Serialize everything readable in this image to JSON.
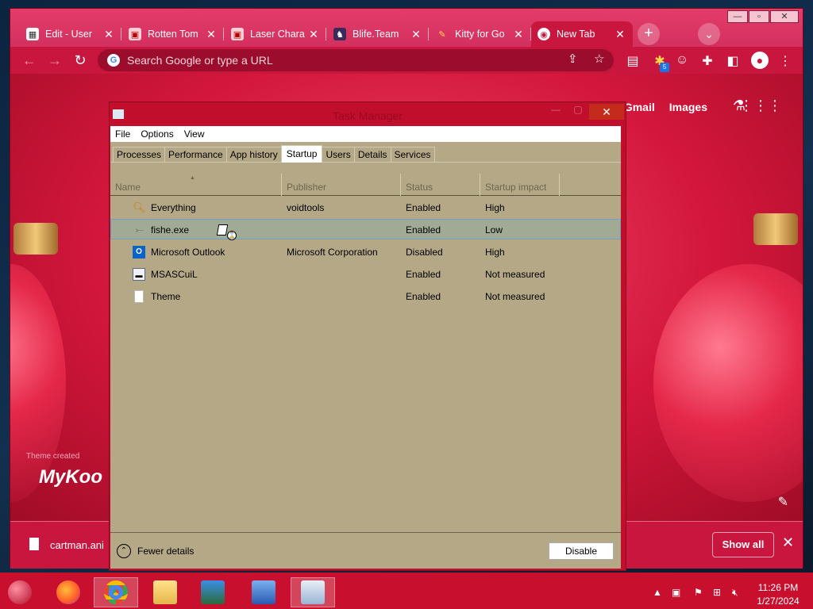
{
  "browser": {
    "window_controls": {
      "minimize": "—",
      "maximize": "▫",
      "close": "✕"
    },
    "tabs": [
      {
        "label": "Edit - User",
        "icon": "document-grid-icon",
        "active": false
      },
      {
        "label": "Rotten Tom",
        "icon": "image-icon",
        "active": false
      },
      {
        "label": "Laser Chara",
        "icon": "image-icon",
        "active": false
      },
      {
        "label": "Blife.Team",
        "icon": "character-icon",
        "active": false
      },
      {
        "label": "Kitty for Go",
        "icon": "kitty-icon",
        "active": false
      },
      {
        "label": "New Tab",
        "icon": "chrome-icon",
        "active": true
      }
    ],
    "new_tab_symbol": "+",
    "tab_search_symbol": "⌄",
    "omnibox_placeholder": "Search Google or type a URL",
    "extension_badge": "5",
    "ntp": {
      "links": [
        "Gmail",
        "Images"
      ],
      "brand_text": "MyKoo",
      "brand_subtext": "Theme created"
    },
    "download_bar": {
      "file_name": "cartman.ani",
      "show_all_label": "Show all",
      "close_symbol": "✕"
    }
  },
  "task_manager": {
    "title": "Task Manager",
    "close_symbol": "✕",
    "menu": [
      "File",
      "Options",
      "View"
    ],
    "tabs": [
      "Processes",
      "Performance",
      "App history",
      "Startup",
      "Users",
      "Details",
      "Services"
    ],
    "active_tab": "Startup",
    "columns": [
      "Name",
      "Publisher",
      "Status",
      "Startup impact"
    ],
    "rows": [
      {
        "name": "Everything",
        "publisher": "voidtools",
        "status": "Enabled",
        "impact": "High",
        "icon": "magnifier-icon",
        "selected": false
      },
      {
        "name": "fishe.exe",
        "publisher": "",
        "status": "Enabled",
        "impact": "Low",
        "icon": "fish-icon",
        "selected": true
      },
      {
        "name": "Microsoft Outlook",
        "publisher": "Microsoft Corporation",
        "status": "Disabled",
        "impact": "High",
        "icon": "outlook-icon",
        "selected": false
      },
      {
        "name": "MSASCuiL",
        "publisher": "",
        "status": "Enabled",
        "impact": "Not measured",
        "icon": "window-icon",
        "selected": false
      },
      {
        "name": "Theme",
        "publisher": "",
        "status": "Enabled",
        "impact": "Not measured",
        "icon": "blank-file-icon",
        "selected": false
      }
    ],
    "fewer_details_label": "Fewer details",
    "disable_button_label": "Disable"
  },
  "taskbar": {
    "apps": [
      {
        "name": "firefox",
        "running": false
      },
      {
        "name": "chrome",
        "running": true
      },
      {
        "name": "file-explorer",
        "running": false
      },
      {
        "name": "remote-desktop",
        "running": false
      },
      {
        "name": "network-tool",
        "running": false
      },
      {
        "name": "task-manager",
        "running": true
      }
    ],
    "clock_time": "11:26 PM",
    "clock_date": "1/27/2024"
  },
  "colors": {
    "accent": "#c9163e",
    "tm_body": "#b5a886",
    "selected_row": "#a0aa94"
  }
}
